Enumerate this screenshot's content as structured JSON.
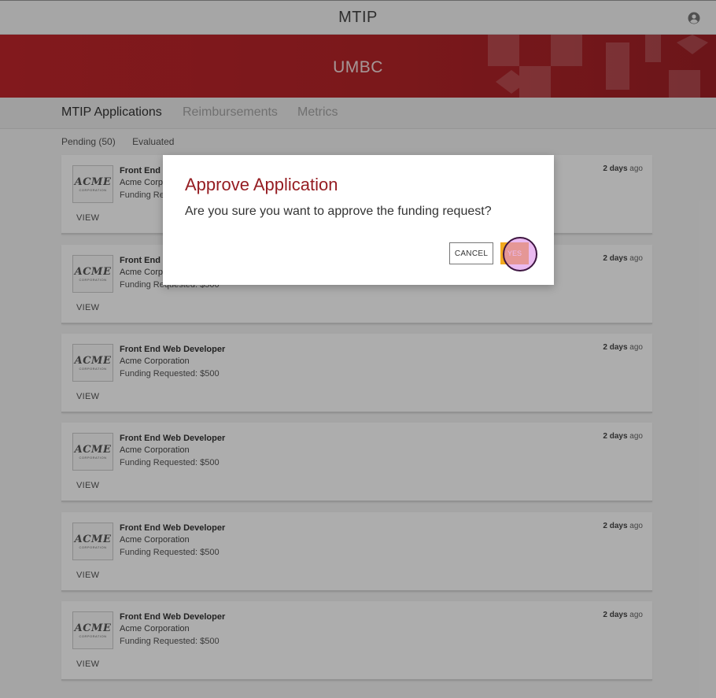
{
  "app": {
    "title": "MTIP",
    "account_icon": "account-circle-icon"
  },
  "banner": {
    "name": "UMBC"
  },
  "nav": {
    "tabs": [
      {
        "label": "MTIP Applications",
        "active": true
      },
      {
        "label": "Reimbursements",
        "active": false
      },
      {
        "label": "Metrics",
        "active": false
      }
    ]
  },
  "filters": {
    "pending": "Pending (50)",
    "evaluated": "Evaluated"
  },
  "applications": [
    {
      "logo": "ACME",
      "logo_sub": "CORPORATION",
      "job": "Front End Web Developer",
      "company": "Acme Corporation",
      "funding": "Funding Requested: $500",
      "view": "VIEW",
      "time_bold": "2 days",
      "time_rest": " ago"
    },
    {
      "logo": "ACME",
      "logo_sub": "CORPORATION",
      "job": "Front End Web Developer",
      "company": "Acme Corporation",
      "funding": "Funding Requested: $500",
      "view": "VIEW",
      "time_bold": "2 days",
      "time_rest": " ago"
    },
    {
      "logo": "ACME",
      "logo_sub": "CORPORATION",
      "job": "Front End Web Developer",
      "company": "Acme Corporation",
      "funding": "Funding Requested: $500",
      "view": "VIEW",
      "time_bold": "2 days",
      "time_rest": " ago"
    },
    {
      "logo": "ACME",
      "logo_sub": "CORPORATION",
      "job": "Front End Web Developer",
      "company": "Acme Corporation",
      "funding": "Funding Requested: $500",
      "view": "VIEW",
      "time_bold": "2 days",
      "time_rest": " ago"
    },
    {
      "logo": "ACME",
      "logo_sub": "CORPORATION",
      "job": "Front End Web Developer",
      "company": "Acme Corporation",
      "funding": "Funding Requested: $500",
      "view": "VIEW",
      "time_bold": "2 days",
      "time_rest": " ago"
    },
    {
      "logo": "ACME",
      "logo_sub": "CORPORATION",
      "job": "Front End Web Developer",
      "company": "Acme Corporation",
      "funding": "Funding Requested: $500",
      "view": "VIEW",
      "time_bold": "2 days",
      "time_rest": " ago"
    }
  ],
  "dialog": {
    "title": "Approve Application",
    "message": "Are you sure you want to approve the funding request?",
    "cancel_label": "CANCEL",
    "yes_label": "YES"
  },
  "colors": {
    "brand_red": "#c0252b",
    "dialog_title": "#951d22",
    "yes_button": "#f2a91e"
  }
}
